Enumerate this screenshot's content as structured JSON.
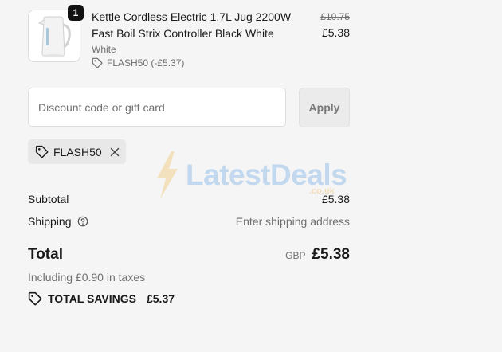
{
  "product": {
    "quantity": "1",
    "title": "Kettle Cordless Electric 1.7L Jug 2200W Fast Boil Strix Controller Black White",
    "variant": "White",
    "discount_tag": "FLASH50 (-£5.37)",
    "original_price": "£10.75",
    "price": "£5.38"
  },
  "discount": {
    "placeholder": "Discount code or gift card",
    "apply_label": "Apply",
    "applied_code": "FLASH50"
  },
  "watermark": {
    "brand": "LatestDeals",
    "domain": ".co.uk"
  },
  "summary": {
    "subtotal_label": "Subtotal",
    "subtotal_value": "£5.38",
    "shipping_label": "Shipping",
    "shipping_value": "Enter shipping address",
    "total_label": "Total",
    "currency": "GBP",
    "total_value": "£5.38",
    "taxes_note": "Including £0.90 in taxes",
    "savings_label": "TOTAL SAVINGS",
    "savings_value": "£5.37"
  },
  "colors": {
    "background": "#f5f5f5",
    "text": "#1a1a1a",
    "muted": "#707070",
    "chip": "#e8e8e8"
  }
}
